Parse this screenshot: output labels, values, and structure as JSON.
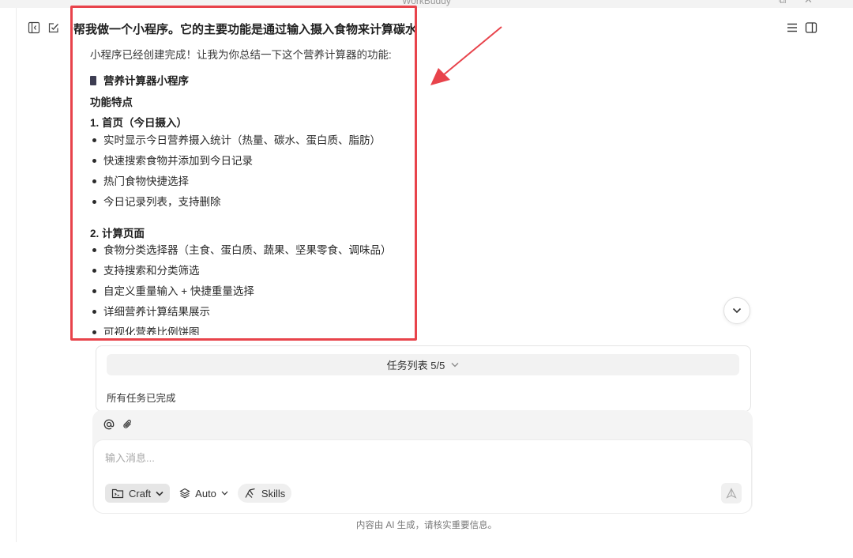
{
  "window": {
    "title": "WorkBuddy"
  },
  "header": {
    "title": "帮我做一个小程序。它的主要功能是通过输入摄入食物来计算碳水、"
  },
  "message": {
    "intro": "小程序已经创建完成！让我为你总结一下这个营养计算器的功能:",
    "app_name": "营养计算器小程序",
    "features_heading": "功能特点",
    "sections": [
      {
        "heading": "1. 首页（今日摄入）",
        "items": [
          "实时显示今日营养摄入统计（热量、碳水、蛋白质、脂肪）",
          "快速搜索食物并添加到今日记录",
          "热门食物快捷选择",
          "今日记录列表，支持删除"
        ]
      },
      {
        "heading": "2. 计算页面",
        "items": [
          "食物分类选择器（主食、蛋白质、蔬果、坚果零食、调味品）",
          "支持搜索和分类筛选",
          "自定义重量输入 + 快捷重量选择",
          "详细营养计算结果展示",
          "可视化营养比例饼图"
        ]
      }
    ]
  },
  "tasks": {
    "label": "任务列表 5/5",
    "status": "所有任务已完成"
  },
  "composer": {
    "placeholder": "输入消息...",
    "craft_label": "Craft",
    "auto_label": "Auto",
    "skills_label": "Skills"
  },
  "footer": {
    "note": "内容由 AI 生成，请核实重要信息。"
  },
  "colors": {
    "highlight": "#e8434b"
  }
}
